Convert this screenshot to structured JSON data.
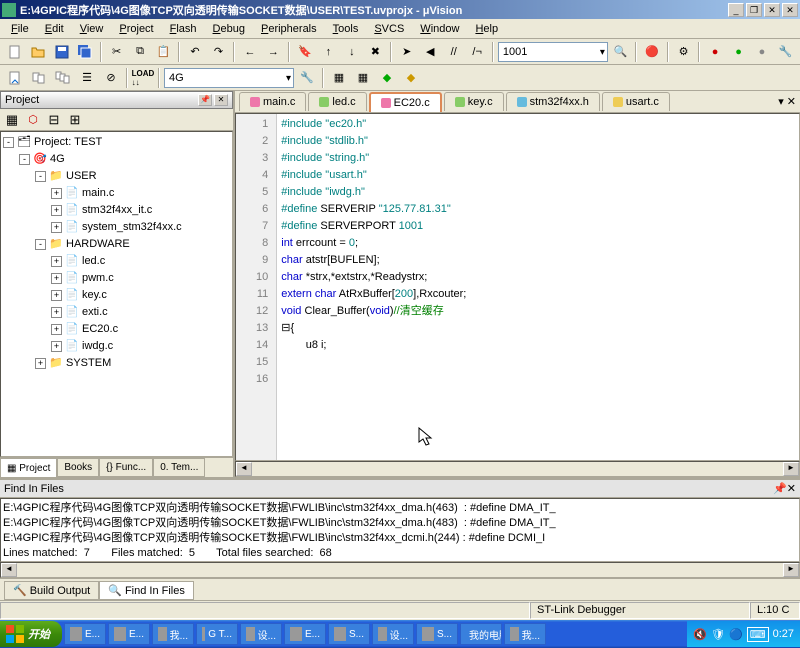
{
  "title": "E:\\4GPIC程序代码\\4G图像TCP双向透明传输SOCKET数据\\USER\\TEST.uvprojx - μVision",
  "menus": [
    "File",
    "Edit",
    "View",
    "Project",
    "Flash",
    "Debug",
    "Peripherals",
    "Tools",
    "SVCS",
    "Window",
    "Help"
  ],
  "target_combo": "4G",
  "quick_combo": "1001",
  "project_panel": {
    "title": "Project",
    "tabs": [
      "Project",
      "Books",
      "{} Func...",
      "0. Tem..."
    ]
  },
  "tree": [
    {
      "depth": 0,
      "exp": "-",
      "icon": "proj",
      "label": "Project: TEST"
    },
    {
      "depth": 1,
      "exp": "-",
      "icon": "target",
      "label": "4G"
    },
    {
      "depth": 2,
      "exp": "-",
      "icon": "folder",
      "label": "USER"
    },
    {
      "depth": 3,
      "exp": "+",
      "icon": "file",
      "label": "main.c"
    },
    {
      "depth": 3,
      "exp": "+",
      "icon": "file",
      "label": "stm32f4xx_it.c"
    },
    {
      "depth": 3,
      "exp": "+",
      "icon": "file",
      "label": "system_stm32f4xx.c"
    },
    {
      "depth": 2,
      "exp": "-",
      "icon": "folder",
      "label": "HARDWARE"
    },
    {
      "depth": 3,
      "exp": "+",
      "icon": "file",
      "label": "led.c"
    },
    {
      "depth": 3,
      "exp": "+",
      "icon": "file",
      "label": "pwm.c"
    },
    {
      "depth": 3,
      "exp": "+",
      "icon": "file",
      "label": "key.c"
    },
    {
      "depth": 3,
      "exp": "+",
      "icon": "file",
      "label": "exti.c"
    },
    {
      "depth": 3,
      "exp": "+",
      "icon": "file",
      "label": "EC20.c"
    },
    {
      "depth": 3,
      "exp": "+",
      "icon": "file",
      "label": "iwdg.c"
    },
    {
      "depth": 2,
      "exp": "+",
      "icon": "folder",
      "label": "SYSTEM"
    }
  ],
  "editor_tabs": [
    {
      "label": "main.c",
      "color": "#e7a"
    },
    {
      "label": "led.c",
      "color": "#8c6"
    },
    {
      "label": "EC20.c",
      "color": "#e7a",
      "active": true
    },
    {
      "label": "key.c",
      "color": "#8c6"
    },
    {
      "label": "stm32f4xx.h",
      "color": "#6bd"
    },
    {
      "label": "usart.c",
      "color": "#ec5"
    }
  ],
  "code": {
    "lines": [
      {
        "n": 1,
        "html": "<span class='pp'>#include</span> <span class='str'>\"ec20.h\"</span>"
      },
      {
        "n": 2,
        "html": "<span class='pp'>#include</span> <span class='str'>\"stdlib.h\"</span>"
      },
      {
        "n": 3,
        "html": "<span class='pp'>#include</span> <span class='str'>\"string.h\"</span>"
      },
      {
        "n": 4,
        "html": "<span class='pp'>#include</span> <span class='str'>\"usart.h\"</span>"
      },
      {
        "n": 5,
        "html": "<span class='pp'>#include</span> <span class='str'>\"iwdg.h\"</span>"
      },
      {
        "n": 6,
        "html": ""
      },
      {
        "n": 7,
        "html": "<span class='pp'>#define</span> SERVERIP <span class='str'>\"125.77.81.31\"</span>"
      },
      {
        "n": 8,
        "html": "<span class='pp'>#define</span> SERVERPORT <span class='num'>1001</span>"
      },
      {
        "n": 9,
        "html": ""
      },
      {
        "n": 10,
        "html": "<span class='kw'>int</span> errcount = <span class='num'>0</span>;"
      },
      {
        "n": 11,
        "html": "<span class='kw'>char</span> atstr[BUFLEN];"
      },
      {
        "n": 12,
        "html": "<span class='kw'>char</span> *strx,*extstrx,*Readystrx;"
      },
      {
        "n": 13,
        "html": "<span class='kw'>extern</span> <span class='kw'>char</span> AtRxBuffer[<span class='num'>200</span>],Rxcouter;"
      },
      {
        "n": 14,
        "html": "<span class='kw'>void</span> Clear_Buffer(<span class='kw'>void</span>)<span class='cmt'>//清空缓存</span>"
      },
      {
        "n": 15,
        "html": "{",
        "fold": true
      },
      {
        "n": 16,
        "html": "        u8 i;"
      }
    ]
  },
  "find": {
    "title": "Find In Files",
    "lines": [
      "E:\\4GPIC程序代码\\4G图像TCP双向透明传输SOCKET数据\\FWLIB\\inc\\stm32f4xx_dma.h(463)  : #define DMA_IT_",
      "E:\\4GPIC程序代码\\4G图像TCP双向透明传输SOCKET数据\\FWLIB\\inc\\stm32f4xx_dma.h(483)  : #define DMA_IT_",
      "E:\\4GPIC程序代码\\4G图像TCP双向透明传输SOCKET数据\\FWLIB\\inc\\stm32f4xx_dcmi.h(244) : #define DCMI_I",
      "Lines matched:  7       Files matched:  5       Total files searched:  68"
    ],
    "tabs": [
      "Build Output",
      "Find In Files"
    ]
  },
  "status": {
    "debugger": "ST-Link Debugger",
    "pos": "L:10 C"
  },
  "taskbar": {
    "start": "开始",
    "items": [
      "E...",
      "E...",
      "我...",
      "G T...",
      "设...",
      "E...",
      "S...",
      "设...",
      "S...",
      "我的电脑",
      "我..."
    ],
    "clock": "0:27"
  }
}
